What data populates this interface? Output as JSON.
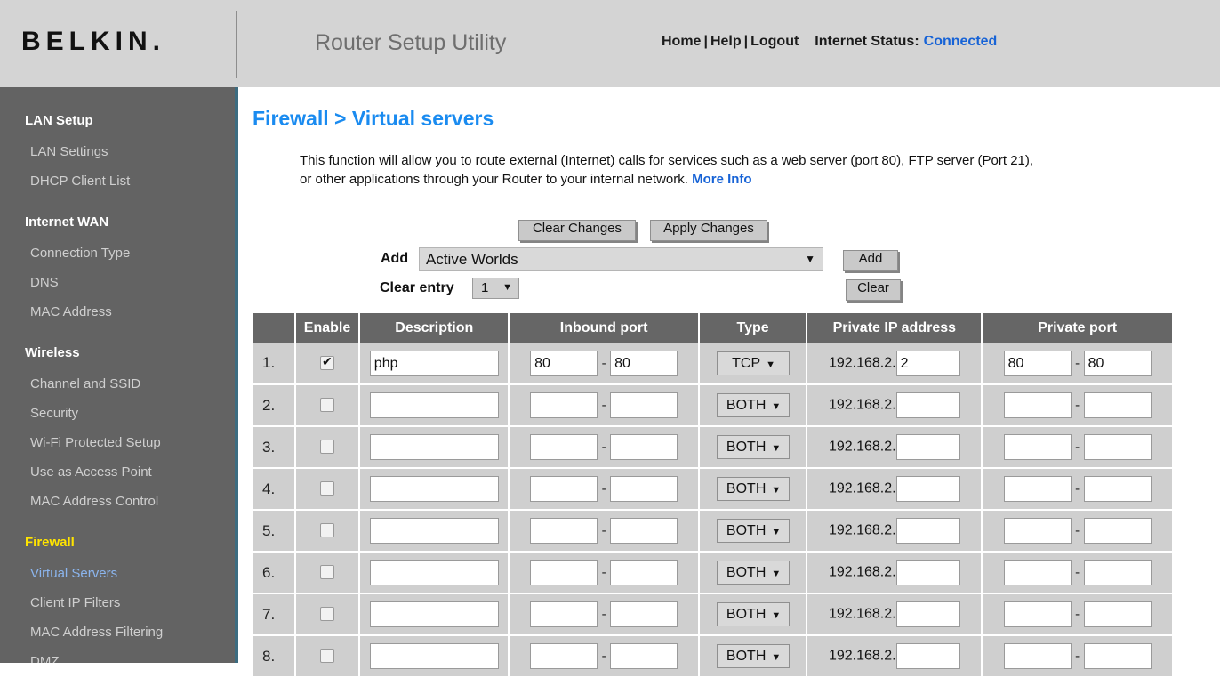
{
  "header": {
    "logo": "BELKIN.",
    "app_title": "Router Setup Utility",
    "nav": {
      "home": "Home",
      "help": "Help",
      "logout": "Logout",
      "sep": "|"
    },
    "internet_status_label": "Internet Status:",
    "internet_status_value": "Connected",
    "status_color": "#1763d6"
  },
  "sidebar": {
    "groups": [
      {
        "label": "LAN Setup",
        "highlighted": false,
        "items": [
          "LAN Settings",
          "DHCP Client List"
        ]
      },
      {
        "label": "Internet WAN",
        "highlighted": false,
        "items": [
          "Connection Type",
          "DNS",
          "MAC Address"
        ]
      },
      {
        "label": "Wireless",
        "highlighted": false,
        "items": [
          "Channel and SSID",
          "Security",
          "Wi-Fi Protected Setup",
          "Use as Access Point",
          "MAC Address Control"
        ]
      },
      {
        "label": "Firewall",
        "highlighted": true,
        "items": [
          "Virtual Servers",
          "Client IP Filters",
          "MAC Address Filtering",
          "DMZ"
        ]
      }
    ],
    "active_item": "Virtual Servers",
    "highlight_color": "#ffe400",
    "active_color": "#8bb5ee"
  },
  "main": {
    "page_title": "Firewall > Virtual servers",
    "description_line1": "This function will allow you to route external (Internet) calls for services such as a web server (port 80),",
    "description_line2": "FTP server (Port 21), or other applications through your Router to your internal network.",
    "more_info": "More Info",
    "title_color": "#1a8bf0"
  },
  "controls": {
    "clear_changes": "Clear Changes",
    "apply_changes": "Apply Changes",
    "add_label": "Add",
    "add_selected": "Active Worlds",
    "add_button": "Add",
    "clear_entry_label": "Clear entry",
    "clear_entry_selected": "1",
    "clear_button": "Clear",
    "caret": "▼"
  },
  "table": {
    "headers": [
      "",
      "Enable",
      "Description",
      "Inbound port",
      "Type",
      "Private IP address",
      "Private port"
    ],
    "ip_prefix": "192.168.2.",
    "dash": "-",
    "rows": [
      {
        "index": "1.",
        "enabled": true,
        "description": "php",
        "inbound_start": "80",
        "inbound_end": "80",
        "type": "TCP",
        "private_ip": "2",
        "private_start": "80",
        "private_end": "80"
      },
      {
        "index": "2.",
        "enabled": false,
        "description": "",
        "inbound_start": "",
        "inbound_end": "",
        "type": "BOTH",
        "private_ip": "",
        "private_start": "",
        "private_end": ""
      },
      {
        "index": "3.",
        "enabled": false,
        "description": "",
        "inbound_start": "",
        "inbound_end": "",
        "type": "BOTH",
        "private_ip": "",
        "private_start": "",
        "private_end": ""
      },
      {
        "index": "4.",
        "enabled": false,
        "description": "",
        "inbound_start": "",
        "inbound_end": "",
        "type": "BOTH",
        "private_ip": "",
        "private_start": "",
        "private_end": ""
      },
      {
        "index": "5.",
        "enabled": false,
        "description": "",
        "inbound_start": "",
        "inbound_end": "",
        "type": "BOTH",
        "private_ip": "",
        "private_start": "",
        "private_end": ""
      },
      {
        "index": "6.",
        "enabled": false,
        "description": "",
        "inbound_start": "",
        "inbound_end": "",
        "type": "BOTH",
        "private_ip": "",
        "private_start": "",
        "private_end": ""
      },
      {
        "index": "7.",
        "enabled": false,
        "description": "",
        "inbound_start": "",
        "inbound_end": "",
        "type": "BOTH",
        "private_ip": "",
        "private_start": "",
        "private_end": ""
      },
      {
        "index": "8.",
        "enabled": false,
        "description": "",
        "inbound_start": "",
        "inbound_end": "",
        "type": "BOTH",
        "private_ip": "",
        "private_start": "",
        "private_end": ""
      }
    ]
  }
}
